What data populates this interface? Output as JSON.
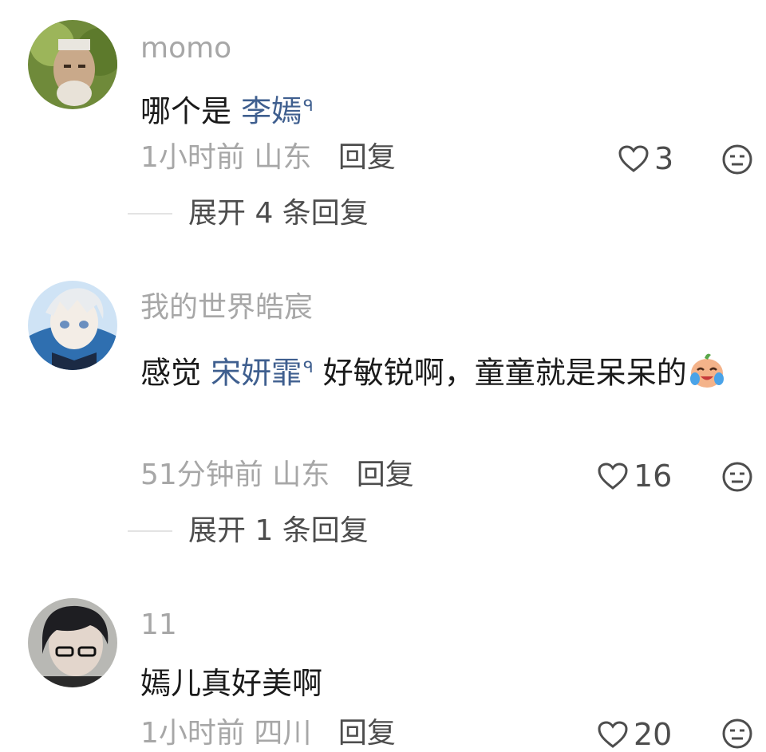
{
  "comments": [
    {
      "username": "momo",
      "text_parts": [
        "哪个是 ",
        "李嫣",
        ""
      ],
      "mention_mark": "ᑫ",
      "time": "1小时前",
      "location": "山东",
      "reply_label": "回复",
      "likes": "3",
      "expand_label": "展开 4 条回复"
    },
    {
      "username": "我的世界皓宸",
      "text_parts": [
        "感觉 ",
        "宋妍霏",
        " 好敏锐啊，童童就是呆呆的"
      ],
      "mention_mark": "ᑫ",
      "emoji": "crying-laughing-emoji",
      "time": "51分钟前",
      "location": "山东",
      "reply_label": "回复",
      "likes": "16",
      "expand_label": "展开 1 条回复"
    },
    {
      "username": "11",
      "text_parts": [
        "嫣儿真好美啊"
      ],
      "time": "1小时前",
      "location": "四川",
      "reply_label": "回复",
      "likes": "20"
    }
  ],
  "icons": {
    "like": "heart-outline-icon",
    "dislike": "neutral-face-icon"
  },
  "colors": {
    "mention": "#3f5f8f",
    "secondary_text": "#a7a7a7",
    "primary_text": "#1a1a1a"
  }
}
